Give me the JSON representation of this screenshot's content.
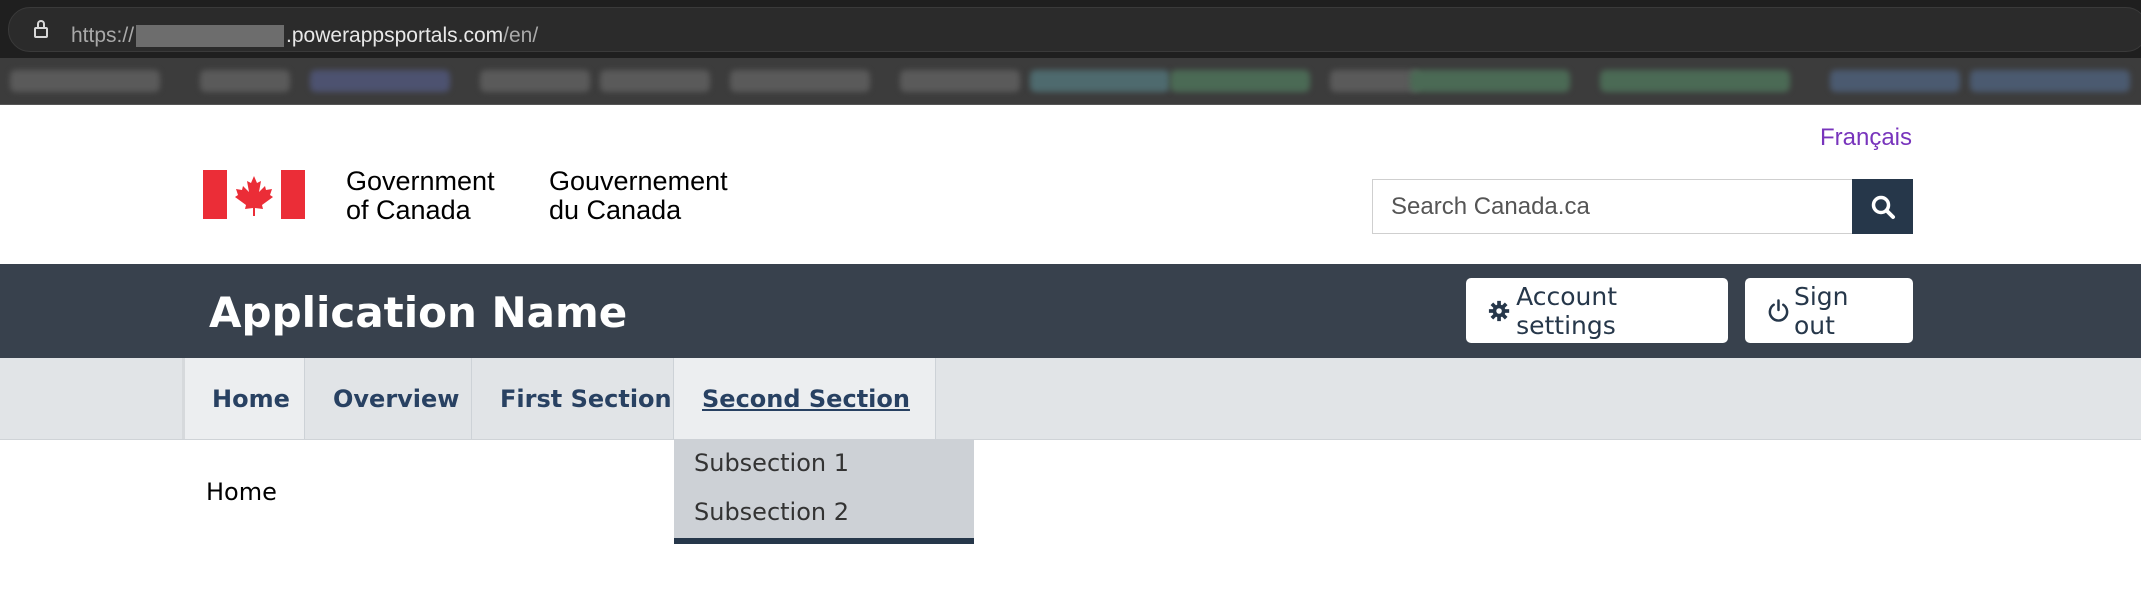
{
  "browser": {
    "url_prefix": "https://",
    "url_domain": ".powerappsportals.com",
    "url_path": "/en/"
  },
  "header": {
    "language_toggle": "Français",
    "signature_en_line1": "Government",
    "signature_en_line2": "of Canada",
    "signature_fr_line1": "Gouvernement",
    "signature_fr_line2": "du Canada",
    "search_placeholder": "Search Canada.ca",
    "search_icon": "search-icon",
    "flag_red": "#eb2d37"
  },
  "app_bar": {
    "app_name": "Application Name",
    "account_settings_label": "Account settings",
    "account_settings_icon": "gear-icon",
    "sign_out_label": "Sign out",
    "sign_out_icon": "power-icon"
  },
  "menu": {
    "items": [
      {
        "label": "Home"
      },
      {
        "label": "Overview"
      },
      {
        "label": "First Section"
      },
      {
        "label": "Second Section"
      }
    ],
    "dropdown": [
      {
        "label": "Subsection 1"
      },
      {
        "label": "Subsection 2"
      }
    ]
  },
  "breadcrumb": {
    "current": "Home"
  },
  "colors": {
    "app_bar_bg": "#38414d",
    "menu_bg": "#e1e4e7",
    "link_purple": "#7834bc",
    "navy": "#26374a"
  }
}
